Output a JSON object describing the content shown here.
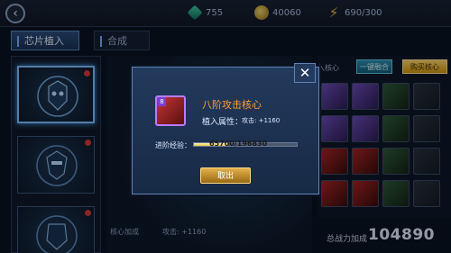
{
  "topbar": {
    "back_icon": "chevron-left-icon",
    "resources": [
      {
        "icon": "cube-icon",
        "value": "755"
      },
      {
        "icon": "coin-icon",
        "value": "40060"
      },
      {
        "icon": "bolt-icon",
        "value": "690/300"
      }
    ]
  },
  "tabs": [
    {
      "label": "芯片植入",
      "active": true
    },
    {
      "label": "合成",
      "active": false
    }
  ],
  "right_panel": {
    "label": "入核心",
    "fuse_button": "一键融合",
    "buy_button": "购买核心"
  },
  "middle": {
    "core_bonus_label": "核心加成",
    "core_bonus_value": "攻击: +1160"
  },
  "footer": {
    "total_power_label": "总战力加成",
    "total_power_value": "104890"
  },
  "dialog": {
    "item_name": "八阶攻击核心",
    "item_level": "8",
    "attr_label": "植入属性：",
    "attr_value": "攻击: +1160",
    "exp_label": "进阶经验：",
    "exp_text": "65700/196830",
    "exp_progress": 0.334,
    "cancel_button": "取出",
    "close_icon": "close-icon"
  }
}
